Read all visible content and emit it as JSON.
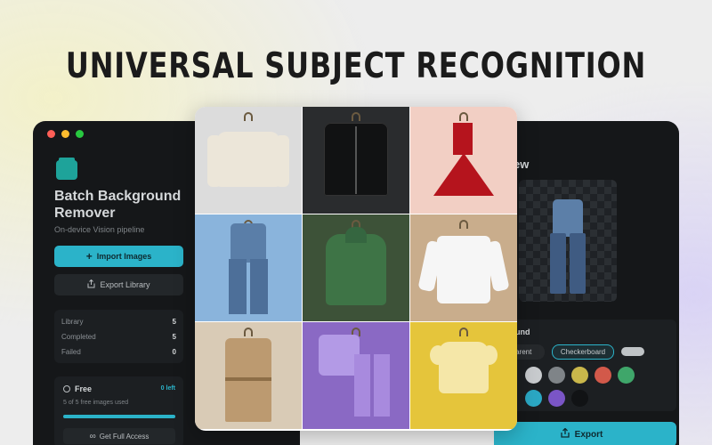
{
  "headline": "UNIVERSAL SUBJECT RECOGNITION",
  "colors": {
    "accent": "#2bb3c9",
    "window_bg": "#151719",
    "panel_bg": "#1c1f22",
    "traffic_lights": [
      "#ff5f57",
      "#febc2e",
      "#28c840"
    ]
  },
  "sidebar": {
    "app_icon": "stacked-layers-icon",
    "app_title": "Batch Background Remover",
    "app_subtitle": "On-device Vision pipeline",
    "import_button": {
      "icon": "plus-icon",
      "label": "Import Images"
    },
    "export_library_button": {
      "icon": "share-icon",
      "label": "Export Library"
    },
    "stats": [
      {
        "label": "Library",
        "value": "5"
      },
      {
        "label": "Completed",
        "value": "5"
      },
      {
        "label": "Failed",
        "value": "0"
      }
    ],
    "plan": {
      "icon": "circle-icon",
      "name": "Free",
      "remaining": "0 left",
      "usage_text": "5 of 5 free images used",
      "usage_fraction": 1.0,
      "upgrade_button": {
        "icon": "infinity-icon",
        "label": "Get Full Access"
      }
    }
  },
  "right_panel": {
    "preview_title": "ew",
    "background": {
      "title": "round",
      "options": [
        "parent",
        "Checkerboard"
      ],
      "selected": "Checkerboard",
      "swatches": [
        "#c8cbce",
        "#7f8488",
        "#c9b74b",
        "#d2594a",
        "#3fa66a",
        "#2ba8c4",
        "#7a55c6",
        "#111315"
      ]
    },
    "export_button": {
      "icon": "share-icon",
      "label": "Export"
    }
  },
  "gallery": [
    {
      "subject": "cream-sweater",
      "bg": "#dcdcdc",
      "color": "#ece6d9"
    },
    {
      "subject": "black-leather-jacket",
      "bg": "#2a2c2e",
      "color": "#111213"
    },
    {
      "subject": "red-dress",
      "bg": "#f2cfc4",
      "color": "#b5141d"
    },
    {
      "subject": "denim-jacket-jeans",
      "bg": "#8ab4dc",
      "color": "#5a7ea8"
    },
    {
      "subject": "green-hoodie",
      "bg": "#3d5238",
      "color": "#3e7446"
    },
    {
      "subject": "white-shirt",
      "bg": "#c9ad8c",
      "color": "#f6f6f6"
    },
    {
      "subject": "trench-coat",
      "bg": "#d9cbb6",
      "color": "#bc9a70"
    },
    {
      "subject": "purple-tracksuit",
      "bg": "#8a69c4",
      "color": "#b39ae6"
    },
    {
      "subject": "yellow-blouse",
      "bg": "#e5c53b",
      "color": "#f5e7a8"
    }
  ]
}
